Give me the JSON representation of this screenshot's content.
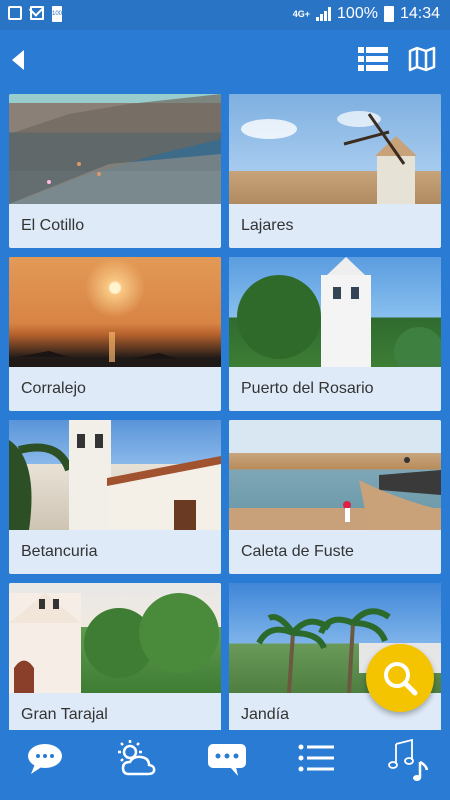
{
  "status_bar": {
    "network": "4G+",
    "battery_percent": "100%",
    "time": "14:34",
    "battery_small": "100"
  },
  "top_bar": {
    "back_icon": "back-arrow-icon",
    "list_view_icon": "list-view-icon",
    "map_view_icon": "map-icon"
  },
  "places": [
    {
      "name": "El Cotillo"
    },
    {
      "name": "Lajares"
    },
    {
      "name": "Corralejo"
    },
    {
      "name": "Puerto del Rosario"
    },
    {
      "name": "Betancuria"
    },
    {
      "name": "Caleta de Fuste"
    },
    {
      "name": "Gran Tarajal"
    },
    {
      "name": "Jandía"
    }
  ],
  "fab": {
    "icon": "search-icon"
  },
  "bottom_nav": [
    {
      "icon": "chat-bubble-icon"
    },
    {
      "icon": "weather-icon"
    },
    {
      "icon": "message-icon"
    },
    {
      "icon": "list-icon"
    },
    {
      "icon": "music-icon"
    }
  ],
  "colors": {
    "primary": "#2a7bd3",
    "status_bar": "#2a74c6",
    "card_background": "#deeaf7",
    "fab": "#f5c400"
  }
}
